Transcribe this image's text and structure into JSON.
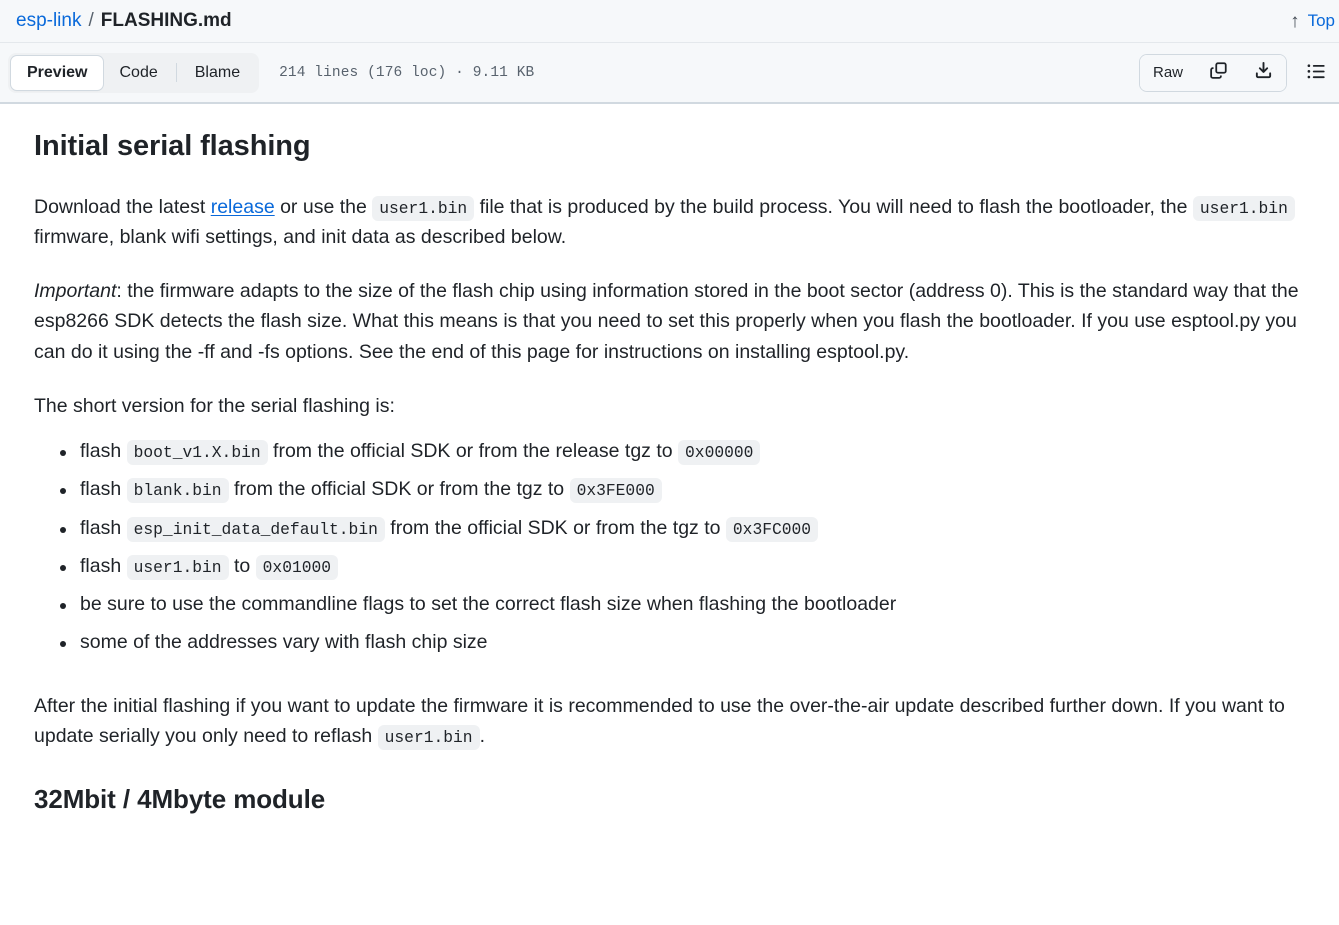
{
  "breadcrumb": {
    "repo": "esp-link",
    "separator": "/",
    "file": "FLASHING.md"
  },
  "top_link": {
    "arrow": "↑",
    "label": "Top"
  },
  "toolbar": {
    "tabs": [
      {
        "label": "Preview",
        "active": true
      },
      {
        "label": "Code",
        "active": false
      },
      {
        "label": "Blame",
        "active": false
      }
    ],
    "file_meta": "214 lines (176 loc) · 9.11 KB",
    "raw_label": "Raw",
    "icons": [
      "copy-icon",
      "download-icon",
      "outline-list-icon"
    ]
  },
  "content": {
    "h1": "Initial serial flashing",
    "p1": {
      "a": "Download the latest ",
      "link": "release",
      "b": " or use the ",
      "code1": "user1.bin",
      "c": " file that is produced by the build process. You will need to flash the bootloader, the ",
      "code2": "user1.bin",
      "d": " firmware, blank wifi settings, and init data as described below."
    },
    "p2": {
      "em": "Important",
      "text": ": the firmware adapts to the size of the flash chip using information stored in the boot sector (address 0). This is the standard way that the esp8266 SDK detects the flash size. What this means is that you need to set this properly when you flash the bootloader. If you use esptool.py you can do it using the -ff and -fs options. See the end of this page for instructions on installing esptool.py."
    },
    "p3": "The short version for the serial flashing is:",
    "list": [
      {
        "a": "flash ",
        "code1": "boot_v1.X.bin",
        "b": " from the official SDK or from the release tgz to ",
        "code2": "0x00000",
        "c": ""
      },
      {
        "a": "flash ",
        "code1": "blank.bin",
        "b": " from the official SDK or from the tgz to ",
        "code2": "0x3FE000",
        "c": ""
      },
      {
        "a": "flash ",
        "code1": "esp_init_data_default.bin",
        "b": " from the official SDK or from the tgz to ",
        "code2": "0x3FC000",
        "c": ""
      },
      {
        "a": "flash ",
        "code1": "user1.bin",
        "b": " to ",
        "code2": "0x01000",
        "c": ""
      },
      {
        "a": "be sure to use the commandline flags to set the correct flash size when flashing the bootloader",
        "code1": "",
        "b": "",
        "code2": "",
        "c": ""
      },
      {
        "a": "some of the addresses vary with flash chip size",
        "code1": "",
        "b": "",
        "code2": "",
        "c": ""
      }
    ],
    "p4": {
      "a": "After the initial flashing if you want to update the firmware it is recommended to use the over-the-air update described further down. If you want to update serially you only need to reflash ",
      "code1": "user1.bin",
      "b": "."
    },
    "h2": "32Mbit / 4Mbyte module"
  },
  "colors": {
    "link": "#0969da",
    "text": "#1f2328",
    "muted": "#59636e",
    "toolbar_bg": "#f6f8fa",
    "code_bg": "#eff1f3",
    "border": "#d1d9e0"
  }
}
